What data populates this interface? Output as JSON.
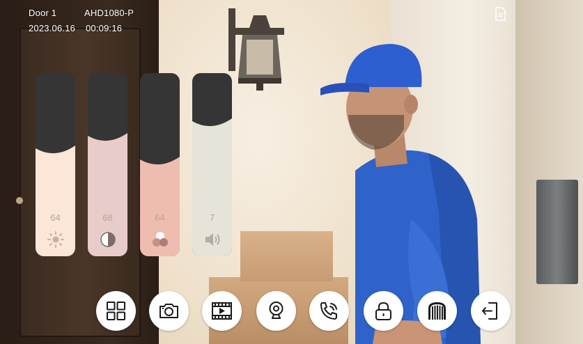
{
  "osd": {
    "door": "Door 1",
    "model": "AHD1080-P",
    "date": "2023.06.16",
    "time": "00:09:16"
  },
  "sliders": [
    {
      "name": "brightness",
      "value": "64",
      "level": 0.55,
      "fill_color": "#fbe6d7",
      "icon": "brightness-icon"
    },
    {
      "name": "contrast",
      "value": "68",
      "level": 0.62,
      "fill_color": "#e8ccca",
      "icon": "contrast-icon"
    },
    {
      "name": "color",
      "value": "64",
      "level": 0.49,
      "fill_color": "#eebdb0",
      "icon": "color-saturation-icon"
    },
    {
      "name": "volume",
      "value": "7",
      "level": 0.7,
      "fill_color": "#e6e4d8",
      "icon": "volume-icon"
    }
  ],
  "toolbar": [
    {
      "name": "split-view",
      "icon": "grid-icon"
    },
    {
      "name": "snapshot",
      "icon": "camera-icon"
    },
    {
      "name": "playback",
      "icon": "film-icon"
    },
    {
      "name": "monitor",
      "icon": "webcam-icon"
    },
    {
      "name": "talk",
      "icon": "phone-call-icon"
    },
    {
      "name": "unlock",
      "icon": "lock-icon"
    },
    {
      "name": "gate",
      "icon": "gate-icon"
    },
    {
      "name": "exit",
      "icon": "exit-icon"
    }
  ],
  "colors": {
    "slider_track": "#353535",
    "button_bg": "#ffffff",
    "icon_stroke": "#1a1a1a"
  }
}
